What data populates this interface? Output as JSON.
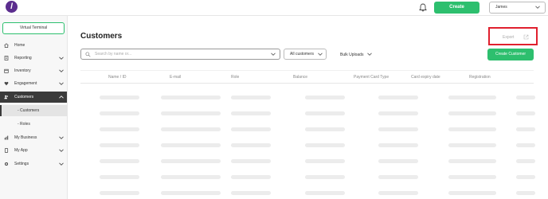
{
  "topbar": {
    "logo_glyph": "l",
    "create_label": "Create",
    "user_name": "James"
  },
  "sidebar": {
    "virtual_terminal": "Virtual Terminal",
    "items": [
      {
        "label": "Home",
        "icon": "home-icon"
      },
      {
        "label": "Reporting",
        "icon": "report-icon"
      },
      {
        "label": "Inventory",
        "icon": "box-icon"
      },
      {
        "label": "Engagement",
        "icon": "heart-icon"
      },
      {
        "label": "Customers",
        "icon": "customers-icon"
      },
      {
        "label": "My Business",
        "icon": "chart-icon"
      },
      {
        "label": "My App",
        "icon": "app-icon"
      },
      {
        "label": "Settings",
        "icon": "settings-icon"
      }
    ],
    "sub_items": [
      "- Customers",
      "- Roles"
    ]
  },
  "main": {
    "title": "Customers",
    "export_label": "Export",
    "search_placeholder": "Search by name or...",
    "filter_value": "All customers",
    "bulk_label": "Bulk Uploads",
    "create_customer_label": "Create Customer",
    "columns": [
      "Name / ID",
      "E-mail",
      "Role",
      "Balance",
      "Payment Card Type",
      "Card expiry date",
      "Registration"
    ]
  },
  "colors": {
    "accent": "#2dbf6e",
    "brand": "#5b2d8e",
    "highlight": "#e0202e",
    "sidebar_active": "#3b3b3b"
  }
}
